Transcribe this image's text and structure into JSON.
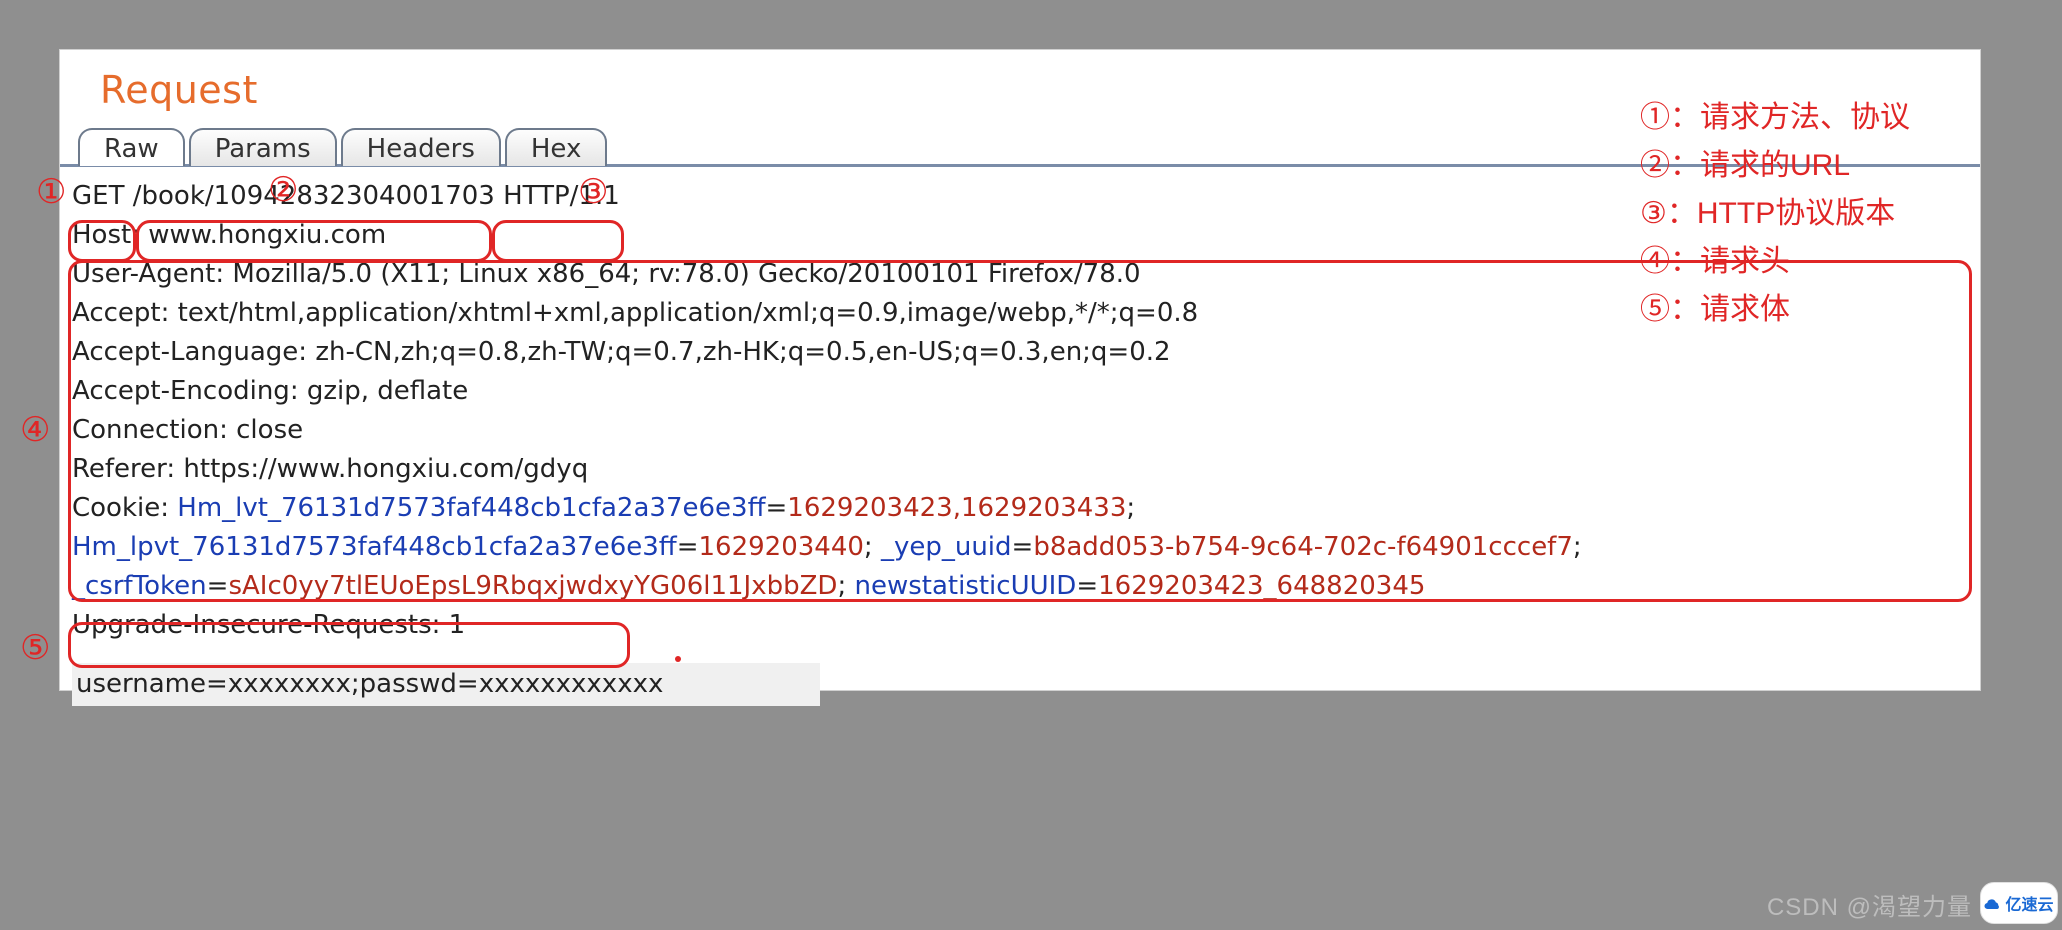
{
  "title": "Request",
  "tabs": {
    "raw": "Raw",
    "params": "Params",
    "headers": "Headers",
    "hex": "Hex"
  },
  "request_line": {
    "method": "GET",
    "url": "/book/10942832304001703",
    "version": "HTTP/1.1"
  },
  "headers": {
    "host": "Host: www.hongxiu.com",
    "ua": "User-Agent: Mozilla/5.0 (X11; Linux x86_64; rv:78.0) Gecko/20100101 Firefox/78.0",
    "accept": "Accept: text/html,application/xhtml+xml,application/xml;q=0.9,image/webp,*/*;q=0.8",
    "accept_lang": "Accept-Language: zh-CN,zh;q=0.8,zh-TW;q=0.7,zh-HK;q=0.5,en-US;q=0.3,en;q=0.2",
    "accept_enc": "Accept-Encoding: gzip, deflate",
    "connection": "Connection: close",
    "referer": "Referer: https://www.hongxiu.com/gdyq",
    "cookie_label": "Cookie: ",
    "cookie_parts": {
      "k1": "Hm_lvt_76131d7573faf448cb1cfa2a37e6e3ff",
      "v1": "1629203423,1629203433",
      "sep1": "; ",
      "k2": "Hm_lpvt_76131d7573faf448cb1cfa2a37e6e3ff",
      "v2": "1629203440",
      "sep2": "; ",
      "k3": "_yep_uuid",
      "v3": "b8add053-b754-9c64-702c-f64901cccef7",
      "sep3": "; ",
      "k4": "_csrfToken",
      "v4": "sAIc0yy7tlEUoEpsL9RbqxjwdxyYG06l11JxbbZD",
      "sep4": "; ",
      "k5": "newstatisticUUID",
      "v5": "1629203423_648820345"
    },
    "upgrade": "Upgrade-Insecure-Requests: 1"
  },
  "body": "username=xxxxxxxx;passwd=xxxxxxxxxxxx",
  "legend": {
    "l1": "①：请求方法、协议",
    "l2": "②：请求的URL",
    "l3": "③：HTTP协议版本",
    "l4": "④：请求头",
    "l5": "⑤：请求体"
  },
  "ann": {
    "n1": "①",
    "n2": "②",
    "n3": "③",
    "n4": "④",
    "n5": "⑤"
  },
  "watermark": "CSDN @渴望力量",
  "logo_text": "亿速云"
}
